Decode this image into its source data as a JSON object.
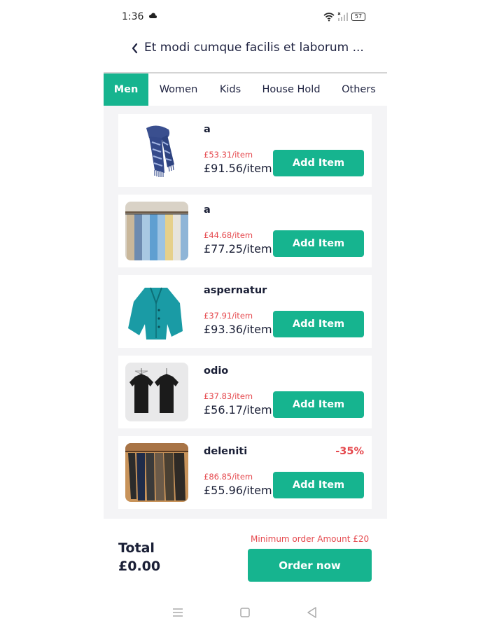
{
  "status_bar": {
    "time": "1:36",
    "battery": "57"
  },
  "header": {
    "title": "Et modi cumque facilis et laborum ..."
  },
  "tabs": [
    {
      "label": "Men",
      "active": true
    },
    {
      "label": "Women",
      "active": false
    },
    {
      "label": "Kids",
      "active": false
    },
    {
      "label": "House Hold",
      "active": false
    },
    {
      "label": "Others",
      "active": false
    }
  ],
  "products": [
    {
      "name": "a",
      "old_price": "£53.31/item",
      "price": "£91.56/item",
      "button": "Add Item",
      "image": "scarf"
    },
    {
      "name": "a",
      "old_price": "£44.68/item",
      "price": "£77.25/item",
      "button": "Add Item",
      "image": "shirts-rack"
    },
    {
      "name": "aspernatur",
      "old_price": "£37.91/item",
      "price": "£93.36/item",
      "button": "Add Item",
      "image": "teal-jacket"
    },
    {
      "name": "odio",
      "old_price": "£37.83/item",
      "price": "£56.17/item",
      "button": "Add Item",
      "image": "black-tshirts"
    },
    {
      "name": "deleniti",
      "old_price": "£86.85/item",
      "price": "£55.96/item",
      "button": "Add Item",
      "discount": "-35%",
      "image": "trousers"
    }
  ],
  "footer": {
    "total_label": "Total",
    "total_value": "£0.00",
    "min_order": "Minimum order Amount £20",
    "order_button": "Order now"
  },
  "colors": {
    "accent": "#16b48f",
    "warning": "#e5484d",
    "text": "#1a1f36",
    "list_bg": "#f4f4f6"
  }
}
